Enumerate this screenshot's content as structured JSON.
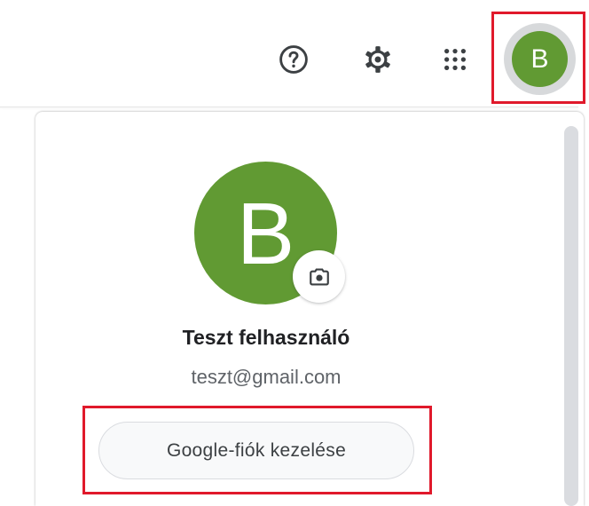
{
  "header": {
    "help_icon": "help-circle-icon",
    "settings_icon": "gear-icon",
    "apps_icon": "apps-grid-icon",
    "avatar_initial": "B"
  },
  "account_panel": {
    "avatar_initial": "B",
    "camera_icon": "camera-icon",
    "name": "Teszt felhasználó",
    "email": "teszt@gmail.com",
    "manage_button_label": "Google-fiók kezelése"
  },
  "colors": {
    "avatar": "#619a33",
    "highlight": "#e0192b",
    "text_primary": "#202124",
    "text_secondary": "#5f6368"
  }
}
